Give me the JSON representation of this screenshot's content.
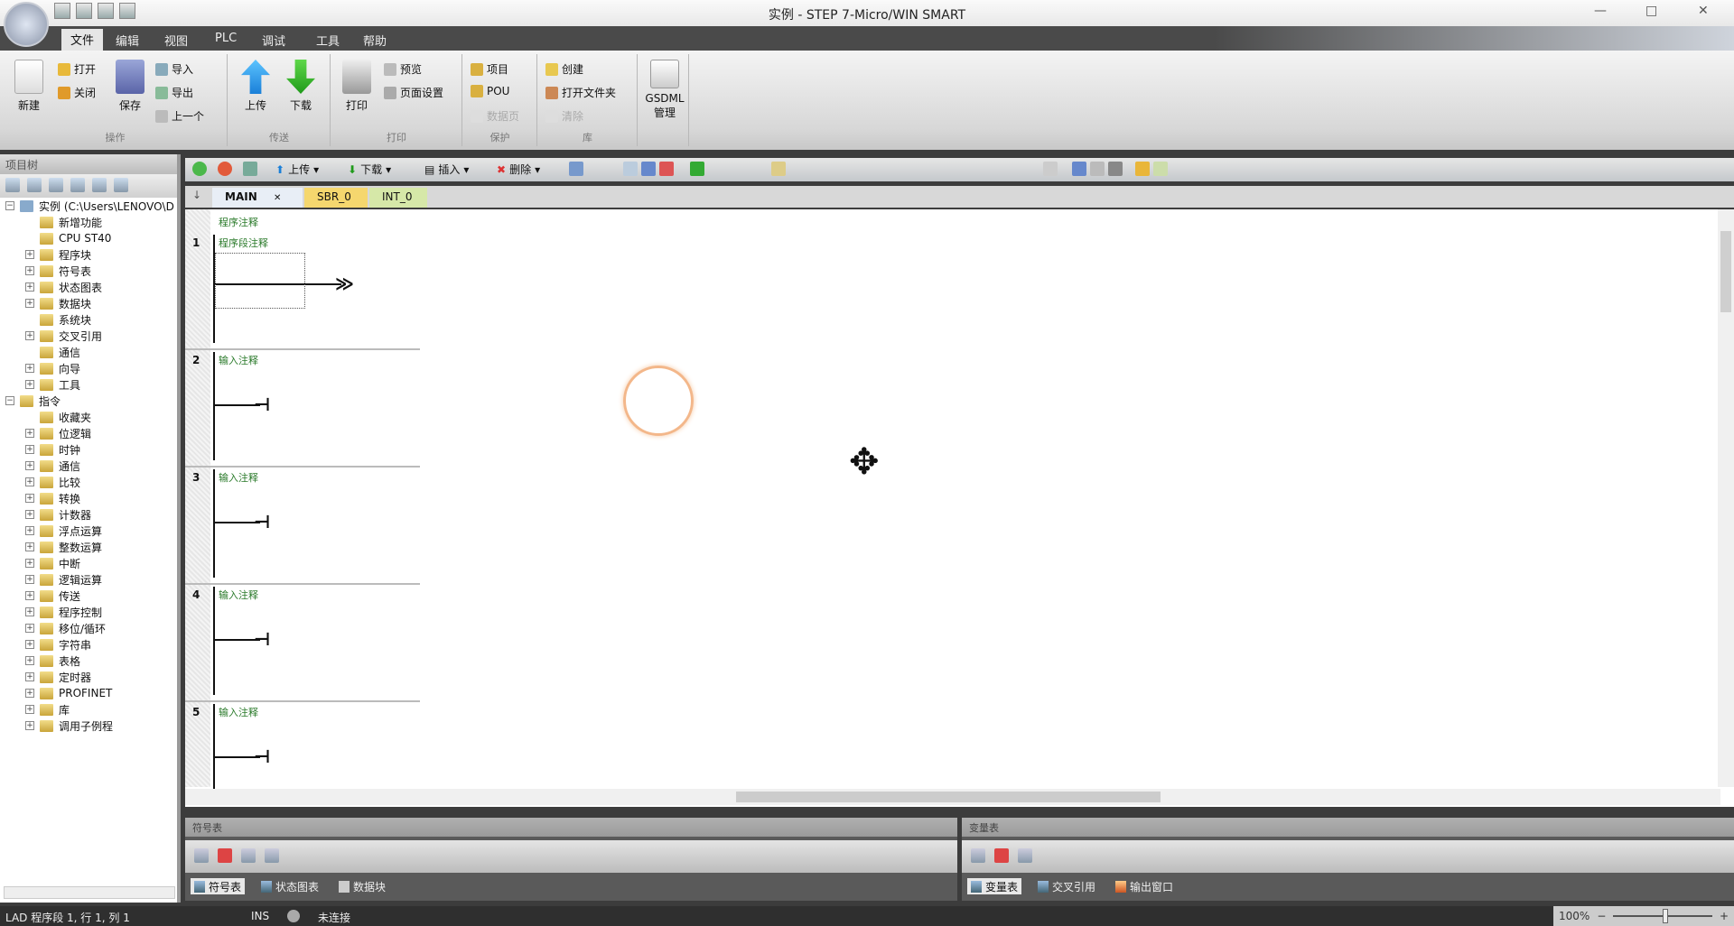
{
  "window": {
    "title": "实例 - STEP 7-Micro/WIN SMART",
    "min": "—",
    "max": "□",
    "close": "✕"
  },
  "menu_tabs": [
    "文件",
    "编辑",
    "视图",
    "PLC",
    "调试",
    "工具",
    "帮助"
  ],
  "ribbon": {
    "groups": [
      {
        "label": "操作"
      },
      {
        "label": "传送"
      },
      {
        "label": "打印"
      },
      {
        "label": "保护"
      },
      {
        "label": "库"
      },
      {
        "label": ""
      }
    ],
    "new": "新建",
    "open": "打开",
    "close": "关闭",
    "save": "保存",
    "import": "导入",
    "export": "导出",
    "previous": "上一个",
    "upload": "上传",
    "download": "下载",
    "print": "打印",
    "preview": "预览",
    "page_setup": "页面设置",
    "project": "项目",
    "pou": "POU",
    "protect_disabled": "数据页",
    "create": "创建",
    "open_folder": "打开文件夹",
    "clear": "清除",
    "gsdml_line1": "GSDML",
    "gsdml_line2": "管理"
  },
  "project_tree": {
    "title": "项目树",
    "root": "实例 (C:\\Users\\LENOVO\\D",
    "items": [
      {
        "label": "新增功能",
        "exp": false
      },
      {
        "label": "CPU ST40",
        "exp": false
      },
      {
        "label": "程序块",
        "exp": true
      },
      {
        "label": "符号表",
        "exp": true
      },
      {
        "label": "状态图表",
        "exp": true
      },
      {
        "label": "数据块",
        "exp": true
      },
      {
        "label": "系统块",
        "exp": false
      },
      {
        "label": "交叉引用",
        "exp": true
      },
      {
        "label": "通信",
        "exp": false
      },
      {
        "label": "向导",
        "exp": true
      },
      {
        "label": "工具",
        "exp": true
      }
    ],
    "instructions_root": "指令",
    "instructions": [
      {
        "label": "收藏夹",
        "exp": false
      },
      {
        "label": "位逻辑",
        "exp": true
      },
      {
        "label": "时钟",
        "exp": true
      },
      {
        "label": "通信",
        "exp": true
      },
      {
        "label": "比较",
        "exp": true
      },
      {
        "label": "转换",
        "exp": true
      },
      {
        "label": "计数器",
        "exp": true
      },
      {
        "label": "浮点运算",
        "exp": true
      },
      {
        "label": "整数运算",
        "exp": true
      },
      {
        "label": "中断",
        "exp": true
      },
      {
        "label": "逻辑运算",
        "exp": true
      },
      {
        "label": "传送",
        "exp": true
      },
      {
        "label": "程序控制",
        "exp": true
      },
      {
        "label": "移位/循环",
        "exp": true
      },
      {
        "label": "字符串",
        "exp": true
      },
      {
        "label": "表格",
        "exp": true
      },
      {
        "label": "定时器",
        "exp": true
      },
      {
        "label": "PROFINET",
        "exp": true
      },
      {
        "label": "库",
        "exp": true
      },
      {
        "label": "调用子例程",
        "exp": true
      }
    ]
  },
  "editor_toolbar": {
    "upload": "上传",
    "download": "下载",
    "insert": "插入",
    "delete": "删除"
  },
  "editor_tabs": [
    {
      "label": "MAIN",
      "color": "#e8eef6",
      "close": "✕"
    },
    {
      "label": "SBR_0",
      "color": "#f5d76e"
    },
    {
      "label": "INT_0",
      "color": "#d6e8a8"
    }
  ],
  "program_comment": "程序注释",
  "networks": [
    {
      "num": "1",
      "comment": "程序段注释"
    },
    {
      "num": "2",
      "comment": "输入注释"
    },
    {
      "num": "3",
      "comment": "输入注释"
    },
    {
      "num": "4",
      "comment": "输入注释"
    },
    {
      "num": "5",
      "comment": "输入注释"
    }
  ],
  "bottom_left": {
    "title": "符号表",
    "tabs": [
      "符号表",
      "状态图表",
      "数据块"
    ]
  },
  "bottom_right": {
    "title": "变量表",
    "tabs": [
      "变量表",
      "交叉引用",
      "输出窗口"
    ]
  },
  "status": {
    "position": "LAD 程序段 1, 行 1, 列 1",
    "mode": "INS",
    "connection": "未连接",
    "zoom": "100%"
  }
}
